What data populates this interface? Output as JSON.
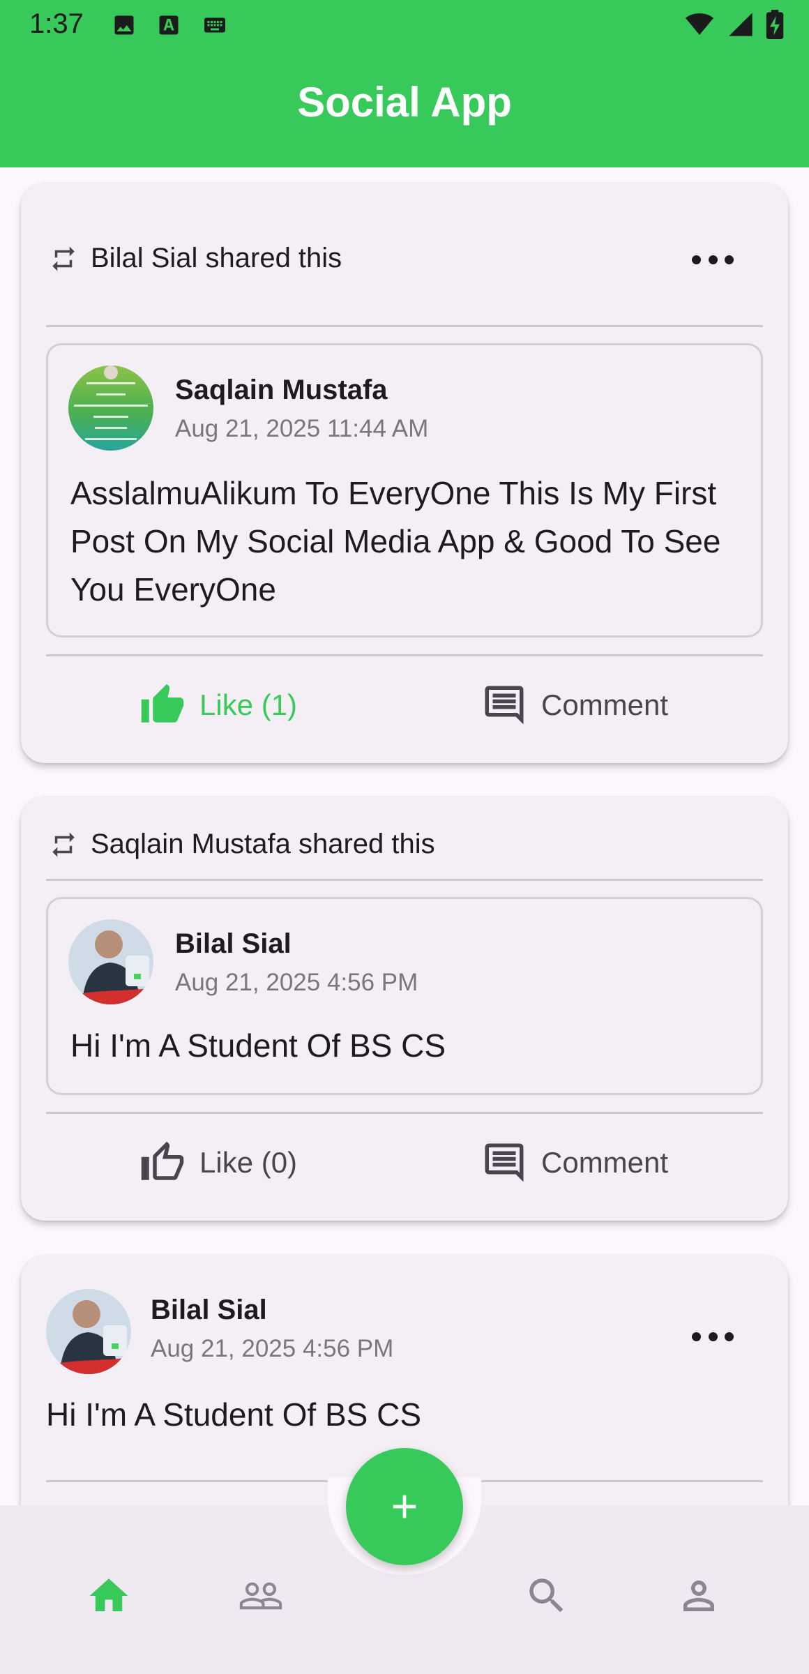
{
  "status_bar": {
    "time": "1:37",
    "icons": [
      "image-icon",
      "text-a-icon",
      "keyboard-icon",
      "wifi-icon",
      "cell-signal-icon",
      "battery-charging-icon"
    ]
  },
  "app_bar": {
    "title": "Social App"
  },
  "colors": {
    "brand": "#37c95a",
    "card": "#f4eff5",
    "background": "#fdf7fd",
    "muted_text": "#7a7680"
  },
  "posts": [
    {
      "shared_by": "Bilal Sial shared this",
      "original": {
        "author": "Saqlain Mustafa",
        "date": "Aug 21, 2025 11:44 AM",
        "text": "AsslalmuAlikum To EveryOne This Is My First Post On My Social Media App & Good To See You EveryOne"
      },
      "like_label": "Like (1)",
      "liked": true,
      "comment_label": "Comment"
    },
    {
      "shared_by": "Saqlain Mustafa shared this",
      "original": {
        "author": "Bilal Sial",
        "date": "Aug 21, 2025 4:56 PM",
        "text": "Hi I'm A Student Of BS CS"
      },
      "like_label": "Like (0)",
      "liked": false,
      "comment_label": "Comment"
    },
    {
      "author": "Bilal Sial",
      "date": "Aug 21, 2025 4:56 PM",
      "text": "Hi I'm A Student Of BS CS"
    }
  ],
  "bottom_nav": {
    "items": [
      "home-icon",
      "people-icon",
      "search-icon",
      "profile-icon"
    ],
    "active": "home-icon"
  },
  "fab": {
    "icon": "plus-icon"
  }
}
